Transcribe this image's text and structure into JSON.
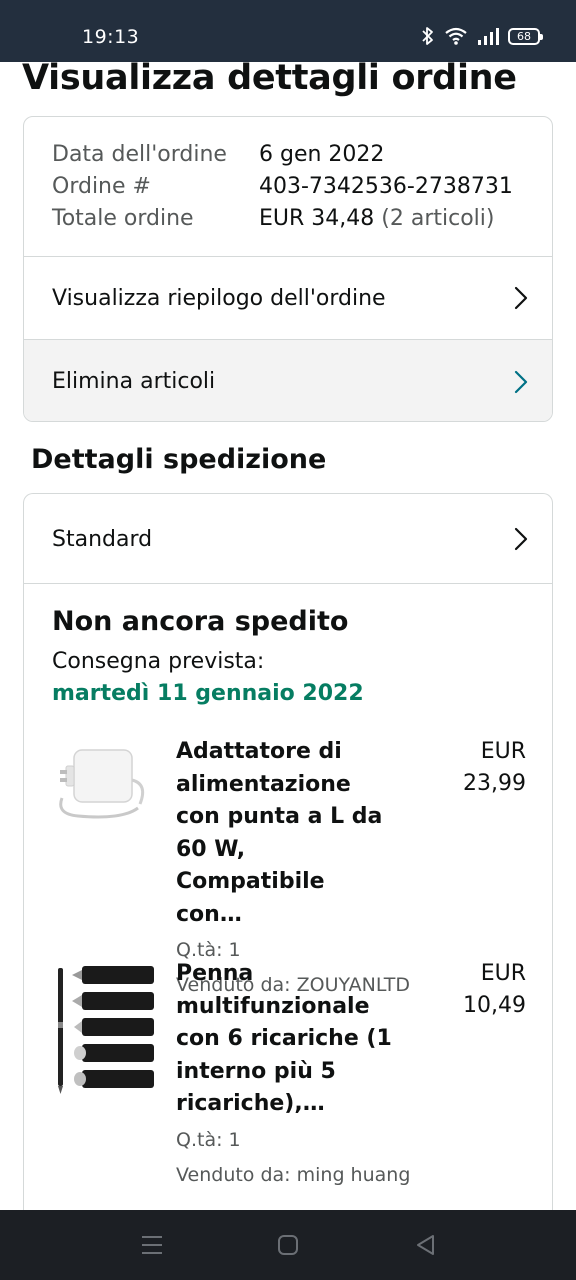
{
  "status_bar": {
    "time": "19:13",
    "battery": "68"
  },
  "page_title": "Visualizza dettagli ordine",
  "order": {
    "date_label": "Data dell'ordine",
    "date_value": "6 gen 2022",
    "number_label": "Ordine #",
    "number_value": "403-7342536-2738731",
    "total_label": "Totale ordine",
    "total_value": "EUR 34,48",
    "total_items": "(2 articoli)"
  },
  "links": {
    "summary": "Visualizza riepilogo dell'ordine",
    "delete_items": "Elimina articoli"
  },
  "shipping": {
    "section_title": "Dettagli spedizione",
    "method": "Standard",
    "status": "Non ancora spedito",
    "delivery_label": "Consegna prevista:",
    "delivery_date": "martedì 11 gennaio 2022"
  },
  "items": [
    {
      "title": "Adattatore di alimentazione con punta a L da 60 W, Compatibile con…",
      "quantity": "Q.tà: 1",
      "seller": "Venduto da: ZOUYANLTD",
      "price": "EUR\n23,99"
    },
    {
      "title": "Penna multifunzionale con 6 ricariche (1 interno più 5 ricariche),…",
      "quantity": "Q.tà: 1",
      "seller": "Venduto da: ming huang",
      "price": "EUR\n10,49"
    }
  ],
  "colors": {
    "status_bar": "#232f3e",
    "delivery_green": "#067d62",
    "link_chevron_teal": "#007185",
    "nav_bar": "#1c1f24"
  },
  "icons": [
    "bluetooth-icon",
    "wifi-icon",
    "signal-icon",
    "battery-icon",
    "chevron-right-icon",
    "menu-icon",
    "home-icon",
    "back-icon"
  ]
}
